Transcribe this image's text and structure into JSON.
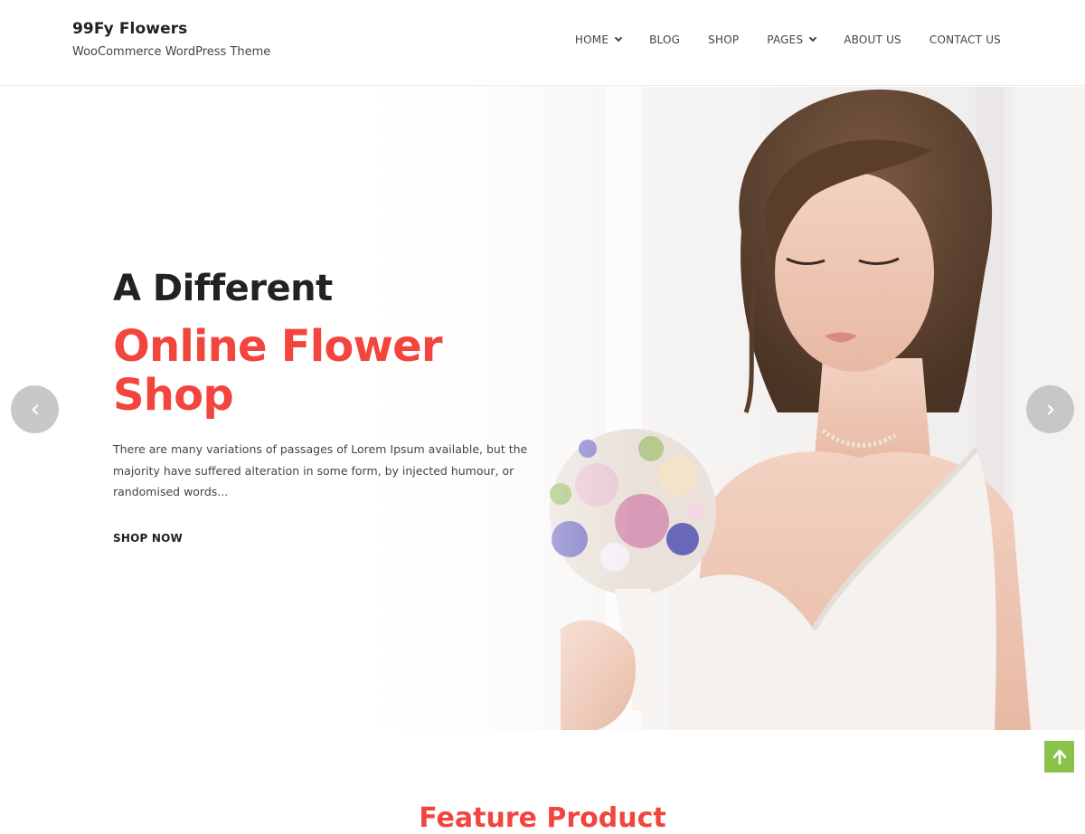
{
  "header": {
    "site_title": "99Fy Flowers",
    "tagline": "WooCommerce WordPress Theme",
    "nav": [
      {
        "label": "HOME",
        "has_dropdown": true
      },
      {
        "label": "BLOG",
        "has_dropdown": false
      },
      {
        "label": "SHOP",
        "has_dropdown": false
      },
      {
        "label": "PAGES",
        "has_dropdown": true
      },
      {
        "label": "ABOUT US",
        "has_dropdown": false
      },
      {
        "label": "CONTACT US",
        "has_dropdown": false
      }
    ]
  },
  "hero": {
    "line1": "A Different",
    "line2": "Online Flower Shop",
    "description": "There are many variations of passages of Lorem Ipsum available, but the majority have suffered alteration in some form, by injected humour, or randomised words...",
    "cta": "SHOP NOW",
    "prev_icon": "chevron-left-icon",
    "next_icon": "chevron-right-icon"
  },
  "section": {
    "heading": "Feature Product"
  },
  "back_to_top": {
    "icon": "arrow-up-icon"
  },
  "colors": {
    "accent": "#f2453d",
    "back_to_top": "#8bc34a",
    "text_dark": "#222222"
  }
}
